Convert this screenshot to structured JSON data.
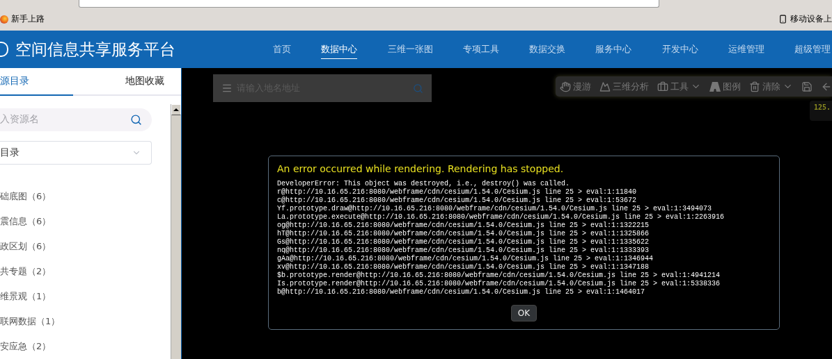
{
  "browser": {
    "bookmarks": [
      {
        "label": "新手上路",
        "kind": "firefox"
      },
      {
        "label": "移动设备上",
        "kind": "phone"
      }
    ]
  },
  "header": {
    "title": "空间信息共享服务平台",
    "nav": [
      {
        "label": "首页",
        "selected": false
      },
      {
        "label": "数据中心",
        "selected": true
      },
      {
        "label": "三维一张图",
        "selected": false
      },
      {
        "label": "专项工具",
        "selected": false
      },
      {
        "label": "数据交换",
        "selected": false
      },
      {
        "label": "服务中心",
        "selected": false
      },
      {
        "label": "开发中心",
        "selected": false
      },
      {
        "label": "运维管理",
        "selected": false
      },
      {
        "label": "超级管理",
        "selected": false
      }
    ]
  },
  "sidebar": {
    "tabs": [
      {
        "label": "源目录",
        "selected": true
      },
      {
        "label": "地图收藏",
        "selected": false
      }
    ],
    "search": {
      "placeholder": "入资源名"
    },
    "dropdown": {
      "value": "目录"
    },
    "items": [
      "础底图（6）",
      "震信息（6）",
      "政区划（6）",
      "共专题（2）",
      "维景观（1）",
      "联网数据（1）",
      "安应急（2）"
    ]
  },
  "map": {
    "search": {
      "placeholder": "请输入地名地址"
    },
    "toolbar": [
      {
        "label": "漫游",
        "kind": "hand",
        "has_menu": false
      },
      {
        "label": "三维分析",
        "kind": "terrain",
        "has_menu": false
      },
      {
        "label": "工具",
        "kind": "briefcase",
        "has_menu": true
      },
      {
        "label": "图例",
        "kind": "road",
        "has_menu": false
      },
      {
        "label": "清除",
        "kind": "trash",
        "has_menu": true
      }
    ],
    "coordinate": "125."
  },
  "dialog": {
    "title": "An error occurred while rendering. Rendering has stopped.",
    "lines": [
      "DeveloperError: This object was destroyed, i.e., destroy() was called.",
      "r@http://10.16.65.216:8080/webframe/cdn/cesium/1.54.0/Cesium.js line 25 > eval:1:11840",
      "c@http://10.16.65.216:8080/webframe/cdn/cesium/1.54.0/Cesium.js line 25 > eval:1:53672",
      "Yf.prototype.draw@http://10.16.65.216:8080/webframe/cdn/cesium/1.54.0/Cesium.js line 25 > eval:1:3494073",
      "La.prototype.execute@http://10.16.65.216:8080/webframe/cdn/cesium/1.54.0/Cesium.js line 25 > eval:1:2263916",
      "og@http://10.16.65.216:8080/webframe/cdn/cesium/1.54.0/Cesium.js line 25 > eval:1:1322215",
      "hT@http://10.16.65.216:8080/webframe/cdn/cesium/1.54.0/Cesium.js line 25 > eval:1:1325866",
      "Gs@http://10.16.65.216:8080/webframe/cdn/cesium/1.54.0/Cesium.js line 25 > eval:1:1335622",
      "nq@http://10.16.65.216:8080/webframe/cdn/cesium/1.54.0/Cesium.js line 25 > eval:1:1333393",
      "gAa@http://10.16.65.216:8080/webframe/cdn/cesium/1.54.0/Cesium.js line 25 > eval:1:1346944",
      "xv@http://10.16.65.216:8080/webframe/cdn/cesium/1.54.0/Cesium.js line 25 > eval:1:1347188",
      "$b.prototype.render@http://10.16.65.216:8080/webframe/cdn/cesium/1.54.0/Cesium.js line 25 > eval:1:4941214",
      "Is.prototype.render@http://10.16.65.216:8080/webframe/cdn/cesium/1.54.0/Cesium.js line 25 > eval:1:5338336",
      "b@http://10.16.65.216:8080/webframe/cdn/cesium/1.54.0/Cesium.js line 25 > eval:1:1464017"
    ],
    "button": "OK"
  }
}
